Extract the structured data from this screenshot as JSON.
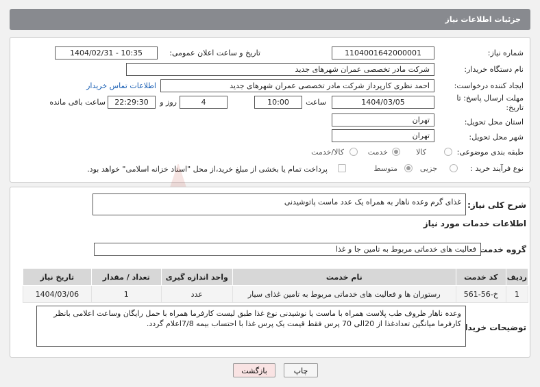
{
  "header": {
    "title": "جزئیات اطلاعات نیاز"
  },
  "form": {
    "need_number_label": "شماره نیاز:",
    "need_number": "1104001642000001",
    "announce_label": "تاریخ و ساعت اعلان عمومی:",
    "announce_value": "1404/02/31 - 10:35",
    "buyer_org_label": "نام دستگاه خریدار:",
    "buyer_org": "شرکت مادر تخصصی عمران شهرهای جدید",
    "requester_label": "ایجاد کننده درخواست:",
    "requester": "احمد نظری کارپرداز شرکت مادر تخصصی عمران شهرهای جدید",
    "contact_link": "اطلاعات تماس خریدار",
    "deadline_label_line1": "مهلت ارسال پاسخ: تا",
    "deadline_label_line2": "تاریخ:",
    "deadline_date": "1404/03/05",
    "time_label": "ساعت",
    "deadline_time": "10:00",
    "days_value": "4",
    "days_label": "روز و",
    "remaining_time": "22:29:30",
    "remaining_label": "ساعت باقی مانده",
    "province_label": "استان محل تحویل:",
    "province": "تهران",
    "city_label": "شهر محل تحویل:",
    "city": "تهران",
    "category_label": "طبقه بندی موضوعی:",
    "category_options": [
      "کالا",
      "خدمت",
      "کالا/خدمت"
    ],
    "process_label": "نوع فرآیند خرید :",
    "process_options": [
      "جزیی",
      "متوسط"
    ],
    "payment_note": "پرداخت تمام یا بخشی از مبلغ خرید،از محل \"اسناد خزانه اسلامی\" خواهد بود."
  },
  "summary": {
    "label": "شرح کلی نیاز:",
    "text": "غذای گرم وعده ناهار به همراه یک عدد ماست پاتوشیدنی"
  },
  "services": {
    "section_title": "اطلاعات خدمات مورد نیاز",
    "group_label": "گروه خدمت:",
    "group_value": "فعالیت های خدماتی مربوط به تامین جا و غذا",
    "columns": [
      "ردیف",
      "کد خدمت",
      "نام خدمت",
      "واحد اندازه گیری",
      "تعداد / مقدار",
      "تاریخ نیاز"
    ],
    "rows": [
      [
        "1",
        "خ-56-561",
        "رستوران ها و فعالیت های خدماتی مربوط به تامین غذای سیار",
        "عدد",
        "1",
        "1404/03/06"
      ]
    ]
  },
  "buyer_notes": {
    "label": "توضیحات خریدار:",
    "text": "وعده ناهار ظروف طب پلاست همراه با ماست یا نوشیدنی نوع غذا طبق لیست کارفرما همراه با حمل رایگان وساعت اعلامی بانظر کارفرما میانگین تعدادغذا از 20الی 70 پرس فقط قیمت یک پرس غذا با احتساب بیمه 7/8اعلام گردد."
  },
  "buttons": {
    "print": "چاپ",
    "back": "بازگشت"
  },
  "colors": {
    "header_bg": "#888a8f",
    "link": "#1a5fb4",
    "back_button": "#f9e3e3"
  }
}
